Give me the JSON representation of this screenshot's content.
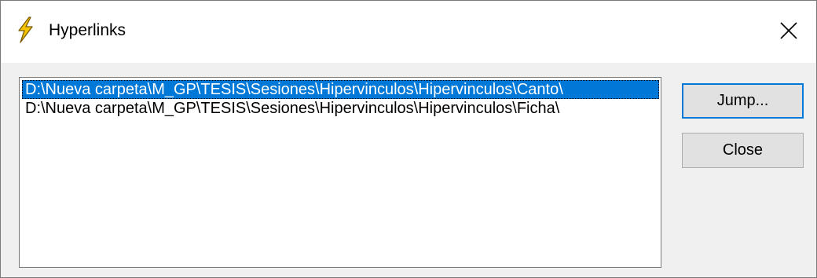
{
  "window": {
    "title": "Hyperlinks",
    "app_icon": "lightning-bolt-icon",
    "close_icon": "close-icon"
  },
  "hyperlinks": {
    "items": [
      {
        "path": "D:\\Nueva carpeta\\M_GP\\TESIS\\Sesiones\\Hipervinculos\\Hipervinculos\\Canto\\",
        "selected": true
      },
      {
        "path": "D:\\Nueva carpeta\\M_GP\\TESIS\\Sesiones\\Hipervinculos\\Hipervinculos\\Ficha\\",
        "selected": false
      }
    ]
  },
  "buttons": {
    "jump_label": "Jump...",
    "close_label": "Close"
  },
  "colors": {
    "selection": "#0078d7",
    "icon_bolt": "#f5c400"
  }
}
